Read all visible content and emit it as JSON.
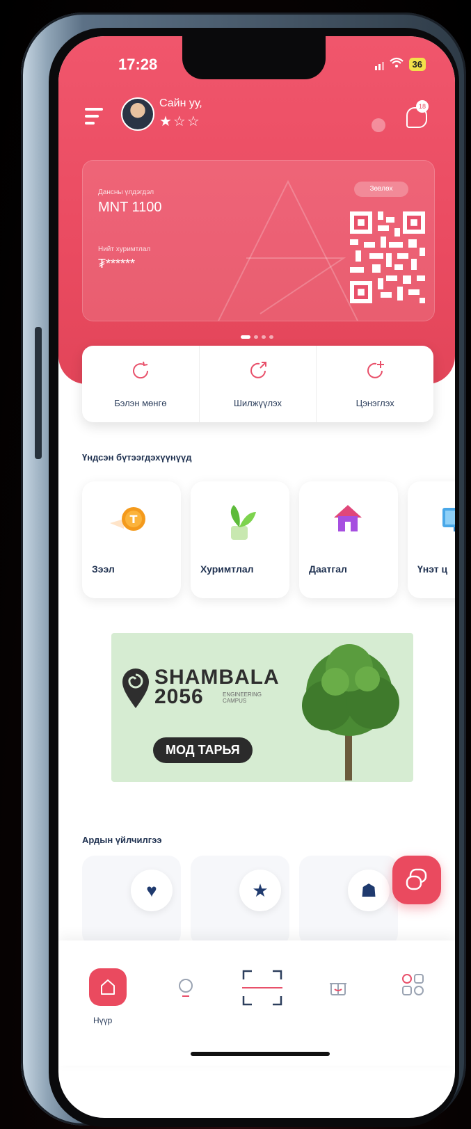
{
  "status_bar": {
    "time": "17:28",
    "battery": "36"
  },
  "header": {
    "greeting": "Сайн уу,",
    "stars": "★☆☆",
    "chat_badge": "18"
  },
  "card": {
    "balance_label": "Дансны үлдэгдэл",
    "balance_value": "MNT 1100",
    "points_label": "Нийт хуримтлал",
    "points_value": "₮******",
    "pill_label": "Зөвлөх"
  },
  "quick_actions": [
    {
      "label": "Бэлэн мөнгө",
      "icon": "cash-refresh-icon"
    },
    {
      "label": "Шилжүүлэх",
      "icon": "transfer-icon"
    },
    {
      "label": "Цэнэглэх",
      "icon": "topup-icon"
    }
  ],
  "products": {
    "title": "Үндсэн бүтээгдэхүүнүүд",
    "items": [
      {
        "label": "Зээл",
        "icon": "coin-icon"
      },
      {
        "label": "Хуримтлал",
        "icon": "plant-icon"
      },
      {
        "label": "Даатгал",
        "icon": "house-icon"
      },
      {
        "label": "Үнэт ц",
        "icon": "monitor-icon"
      }
    ]
  },
  "banner": {
    "brand_line1": "SHAMBALA",
    "brand_line2": "2056",
    "brand_sub": "ENGINEERING CAMPUS",
    "cta": "МОД ТАРЬЯ"
  },
  "services": {
    "title": "Ардын үйлчилгээ",
    "items": [
      {
        "icon": "heart-icon"
      },
      {
        "icon": "star-icon"
      },
      {
        "icon": "bell-icon"
      }
    ]
  },
  "bottom_nav": {
    "home_label": "Нүүр",
    "items": [
      "home-icon",
      "bulb-icon",
      "scan-icon",
      "gift-icon",
      "apps-icon"
    ]
  },
  "colors": {
    "brand": "#ea4a5f",
    "text_dark": "#1f3150",
    "banner_bg": "#d6ecd2"
  }
}
